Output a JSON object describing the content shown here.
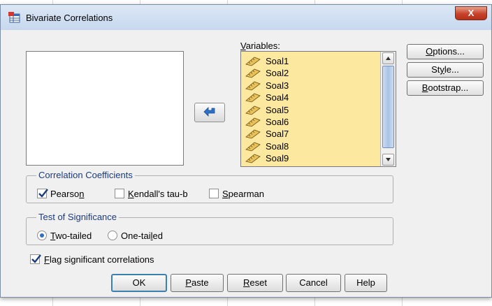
{
  "window": {
    "title": "Bivariate Correlations",
    "close_label": "X"
  },
  "variables": {
    "label": "Variables:",
    "items": [
      "Soal1",
      "Soal2",
      "Soal3",
      "Soal4",
      "Soal5",
      "Soal6",
      "Soal7",
      "Soal8",
      "Soal9"
    ]
  },
  "side_buttons": {
    "options": "Options...",
    "style": "Style...",
    "bootstrap": "Bootstrap..."
  },
  "correlation": {
    "legend": "Correlation Coefficients",
    "pearson": {
      "label": "Pearson",
      "checked": true
    },
    "kendall": {
      "label": "Kendall's tau-b",
      "checked": false
    },
    "spearman": {
      "label": "Spearman",
      "checked": false
    }
  },
  "significance": {
    "legend": "Test of Significance",
    "two_tailed": {
      "label": "Two-tailed",
      "selected": true
    },
    "one_tailed": {
      "label": "One-tailed",
      "selected": false
    }
  },
  "flag": {
    "label": "Flag significant correlations",
    "checked": true
  },
  "buttons": {
    "ok": "OK",
    "paste": "Paste",
    "reset": "Reset",
    "cancel": "Cancel",
    "help": "Help"
  },
  "colors": {
    "variables_bg": "#fde8a0",
    "accent": "#2f6fc4",
    "group_legend": "#1b3a7a"
  }
}
